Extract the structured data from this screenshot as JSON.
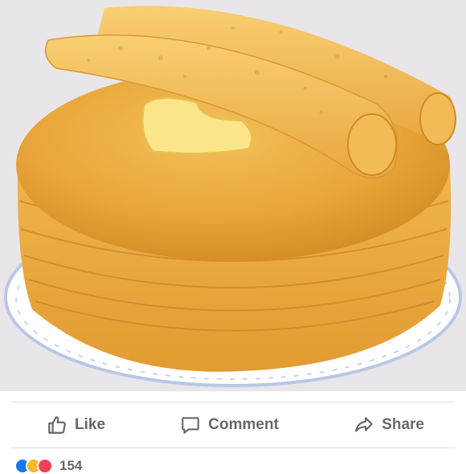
{
  "post": {
    "photo_alt": "stack of pancakes with butter"
  },
  "actions": {
    "like_label": "Like",
    "comment_label": "Comment",
    "share_label": "Share"
  },
  "reactions": {
    "icons": [
      "like-icon",
      "haha-icon",
      "love-icon"
    ],
    "colors": {
      "like": "#1877f2",
      "haha": "#f7b928",
      "love": "#f33e58"
    },
    "count": "154"
  },
  "theme": {
    "action_text_color": "#65676b",
    "divider_color": "#dadde1"
  }
}
